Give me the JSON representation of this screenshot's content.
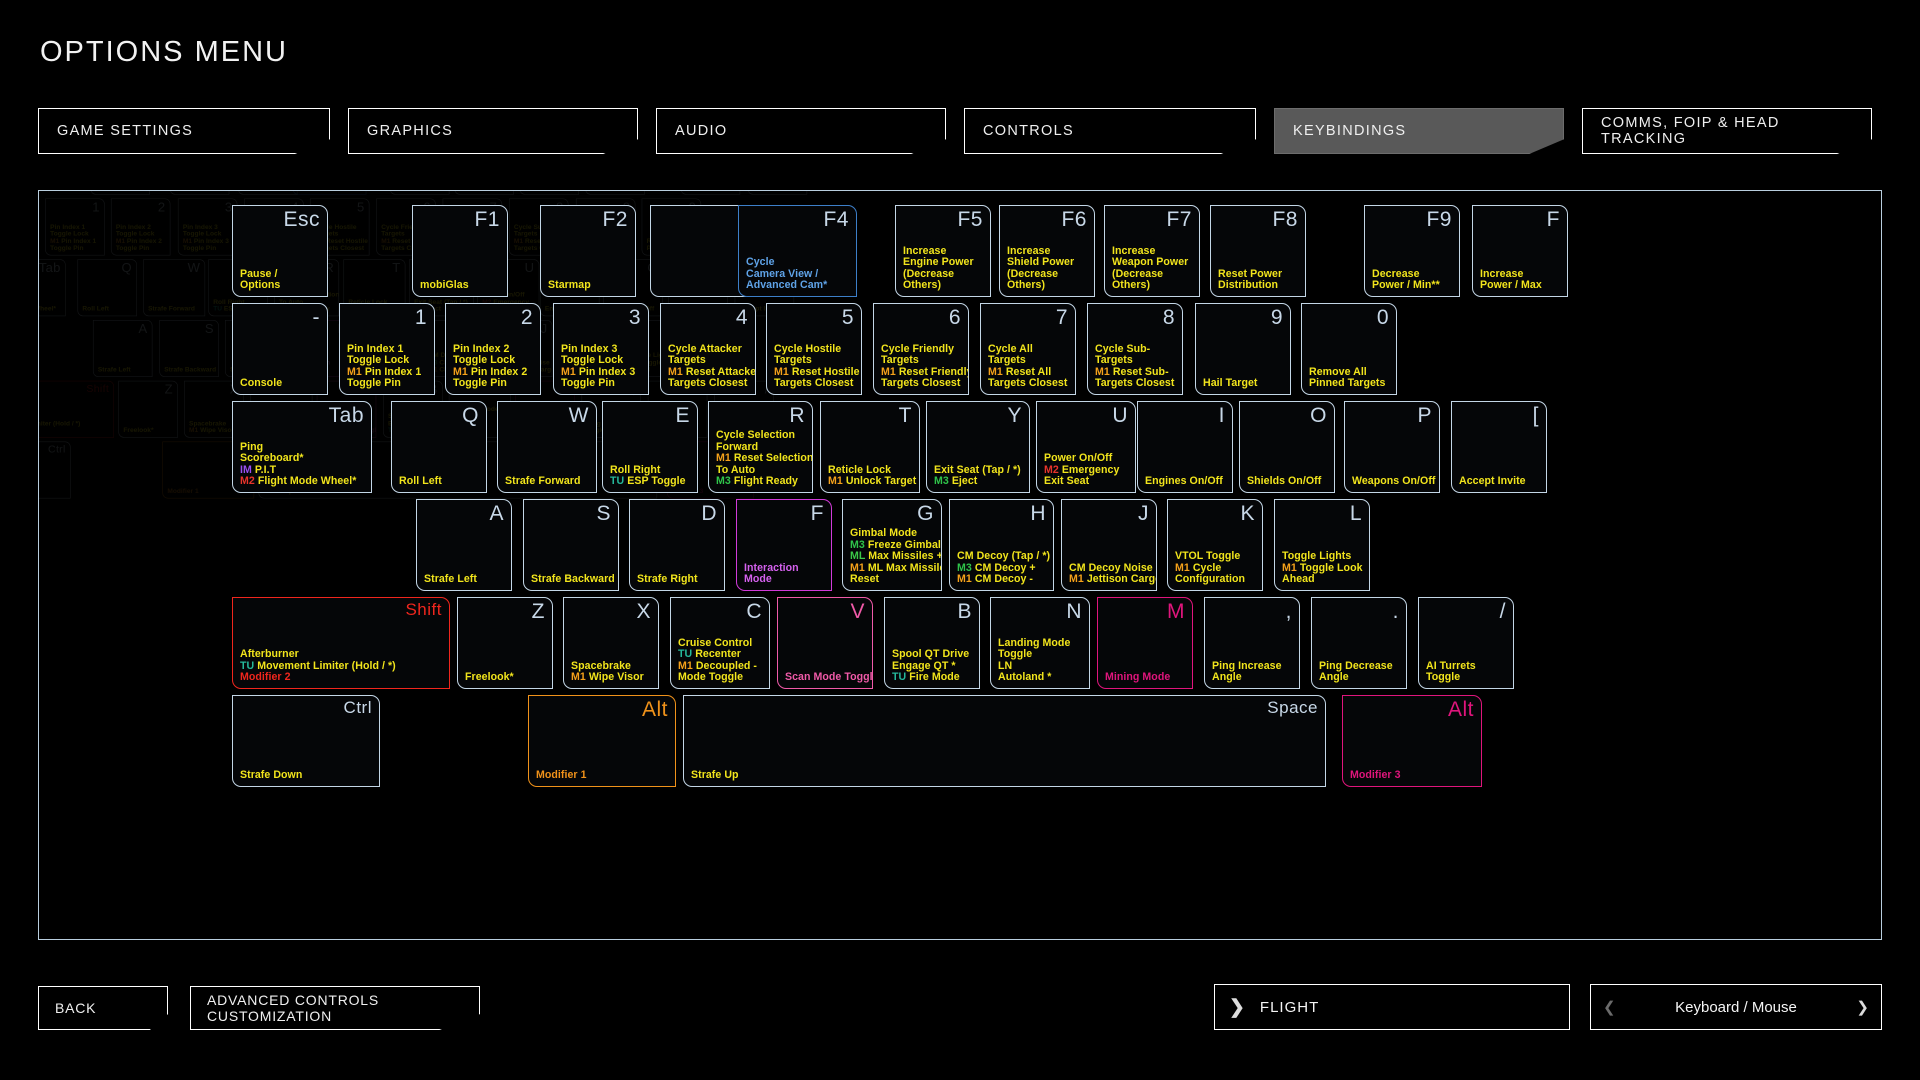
{
  "header": {
    "title": "OPTIONS MENU"
  },
  "tabs": [
    {
      "label": "GAME SETTINGS",
      "selected": false
    },
    {
      "label": "GRAPHICS",
      "selected": false
    },
    {
      "label": "AUDIO",
      "selected": false
    },
    {
      "label": "CONTROLS",
      "selected": false
    },
    {
      "label": "KEYBINDINGS",
      "selected": true
    },
    {
      "label": "COMMS, FOIP & HEAD TRACKING",
      "selected": false
    }
  ],
  "footer": {
    "back_label": "BACK",
    "advanced_label": "ADVANCED CONTROLS CUSTOMIZATION",
    "flight_label": "FLIGHT",
    "flight_icon": "chevron-right-icon",
    "device_label": "Keyboard / Mouse",
    "device_prev_icon": "chevron-left-icon",
    "device_next_icon": "chevron-right-icon"
  },
  "modifier_colors": {
    "M1": "#f5a11a",
    "M2": "#e8342b",
    "M3": "#2fc44a",
    "IM": "#9a4ff0",
    "TU": "#25b89b",
    "LN": "#f2e51c",
    "ML": "#3bc948",
    "LM": "#3bc948"
  },
  "highlight_colors": {
    "blue": "#3d7fc9",
    "magenta": "#d13ad8",
    "red": "#f0261d",
    "pink": "#f05aa8",
    "crimson": "#e0157c",
    "orange": "#f0921a"
  },
  "keyboard": {
    "row_f": [
      {
        "cap": "Esc",
        "lines": [
          {
            "t": "Pause /"
          },
          {
            "t": "Options"
          }
        ]
      },
      {
        "cap": "F1",
        "lines": [
          {
            "t": "mobiGlas"
          }
        ]
      },
      {
        "cap": "F2",
        "lines": [
          {
            "t": "Starmap"
          }
        ]
      },
      {
        "cap": "",
        "lines": []
      },
      {
        "cap": "F4",
        "highlight": "blue",
        "lines": [
          {
            "t": "Cycle",
            "c": "blue"
          },
          {
            "t": "Camera View /",
            "c": "blue"
          },
          {
            "t": "Advanced Cam*",
            "c": "blue"
          }
        ]
      },
      {
        "cap": "F5",
        "lines": [
          {
            "t": "Increase"
          },
          {
            "t": "Engine Power"
          },
          {
            "t": "(Decrease"
          },
          {
            "t": "Others)"
          }
        ]
      },
      {
        "cap": "F6",
        "lines": [
          {
            "t": "Increase"
          },
          {
            "t": "Shield Power"
          },
          {
            "t": "(Decrease"
          },
          {
            "t": "Others)"
          }
        ]
      },
      {
        "cap": "F7",
        "lines": [
          {
            "t": "Increase"
          },
          {
            "t": "Weapon Power"
          },
          {
            "t": "(Decrease"
          },
          {
            "t": "Others)"
          }
        ]
      },
      {
        "cap": "F8",
        "lines": [
          {
            "t": "Reset Power"
          },
          {
            "t": "Distribution"
          }
        ]
      },
      {
        "cap": "F9",
        "lines": [
          {
            "t": "Decrease"
          },
          {
            "t": "Power / Min**"
          }
        ]
      },
      {
        "cap": "F",
        "lines": [
          {
            "t": "Increase"
          },
          {
            "t": "Power / Max"
          }
        ]
      }
    ],
    "row_num": [
      {
        "cap": "-",
        "lines": [
          {
            "t": "Console"
          }
        ]
      },
      {
        "cap": "1",
        "lines": [
          {
            "t": "Pin Index 1"
          },
          {
            "t": "Toggle Lock"
          },
          {
            "m": "M1",
            "t": "Pin Index 1"
          },
          {
            "t": "Toggle Pin"
          }
        ]
      },
      {
        "cap": "2",
        "lines": [
          {
            "t": "Pin Index 2"
          },
          {
            "t": "Toggle Lock"
          },
          {
            "m": "M1",
            "t": "Pin Index 2"
          },
          {
            "t": "Toggle Pin"
          }
        ]
      },
      {
        "cap": "3",
        "lines": [
          {
            "t": "Pin Index 3"
          },
          {
            "t": "Toggle Lock"
          },
          {
            "m": "M1",
            "t": "Pin Index 3"
          },
          {
            "t": "Toggle Pin"
          }
        ]
      },
      {
        "cap": "4",
        "lines": [
          {
            "t": "Cycle Attacker"
          },
          {
            "t": "Targets"
          },
          {
            "m": "M1",
            "t": "Reset Attacker"
          },
          {
            "t": "Targets Closest"
          }
        ]
      },
      {
        "cap": "5",
        "lines": [
          {
            "t": "Cycle Hostile"
          },
          {
            "t": "Targets"
          },
          {
            "m": "M1",
            "t": "Reset Hostile"
          },
          {
            "t": "Targets Closest"
          }
        ]
      },
      {
        "cap": "6",
        "lines": [
          {
            "t": "Cycle Friendly"
          },
          {
            "t": "Targets"
          },
          {
            "m": "M1",
            "t": "Reset Friendly"
          },
          {
            "t": "Targets Closest"
          }
        ]
      },
      {
        "cap": "7",
        "lines": [
          {
            "t": "Cycle All"
          },
          {
            "t": "Targets"
          },
          {
            "m": "M1",
            "t": "Reset All"
          },
          {
            "t": "Targets Closest"
          }
        ]
      },
      {
        "cap": "8",
        "lines": [
          {
            "t": "Cycle Sub-"
          },
          {
            "t": "Targets"
          },
          {
            "m": "M1",
            "t": "Reset Sub-"
          },
          {
            "t": "Targets Closest"
          }
        ]
      },
      {
        "cap": "9",
        "lines": [
          {
            "t": "Hail Target"
          }
        ]
      },
      {
        "cap": "0",
        "lines": [
          {
            "t": "Remove All"
          },
          {
            "t": "Pinned Targets"
          }
        ]
      }
    ],
    "row_q": [
      {
        "cap": "Tab",
        "lines": [
          {
            "t": "Ping"
          },
          {
            "t": "Scoreboard*"
          },
          {
            "m": "IM",
            "t": "P.I.T"
          },
          {
            "m": "M2",
            "t": "Flight Mode Wheel*"
          }
        ]
      },
      {
        "cap": "Q",
        "lines": [
          {
            "t": "Roll Left"
          }
        ]
      },
      {
        "cap": "W",
        "lines": [
          {
            "t": "Strafe Forward"
          }
        ]
      },
      {
        "cap": "E",
        "lines": [
          {
            "t": "Roll Right"
          },
          {
            "m": "TU",
            "t": "ESP Toggle"
          }
        ]
      },
      {
        "cap": "R",
        "lines": [
          {
            "t": "Cycle Selection"
          },
          {
            "t": "Forward"
          },
          {
            "m": "M1",
            "t": "Reset Selection"
          },
          {
            "t": "To Auto"
          },
          {
            "m": "M3",
            "t": "Flight Ready"
          }
        ]
      },
      {
        "cap": "T",
        "lines": [
          {
            "t": "Reticle Lock"
          },
          {
            "m": "M1",
            "t": "Unlock Target"
          }
        ]
      },
      {
        "cap": "Y",
        "lines": [
          {
            "t": "Exit Seat (Tap / *)"
          },
          {
            "m": "M3",
            "t": "Eject"
          }
        ]
      },
      {
        "cap": "U",
        "lines": [
          {
            "t": "Power On/Off"
          },
          {
            "m": "M2",
            "t": "Emergency"
          },
          {
            "t": "Exit Seat"
          }
        ]
      },
      {
        "cap": "I",
        "lines": [
          {
            "t": "Engines On/Off"
          }
        ]
      },
      {
        "cap": "O",
        "lines": [
          {
            "t": "Shields On/Off"
          }
        ]
      },
      {
        "cap": "P",
        "lines": [
          {
            "t": "Weapons On/Off"
          }
        ]
      },
      {
        "cap": "[",
        "lines": [
          {
            "t": "Accept Invite"
          }
        ]
      }
    ],
    "row_a": [
      {
        "cap": "A",
        "lines": [
          {
            "t": "Strafe Left"
          }
        ]
      },
      {
        "cap": "S",
        "lines": [
          {
            "t": "Strafe Backward"
          }
        ]
      },
      {
        "cap": "D",
        "lines": [
          {
            "t": "Strafe Right"
          }
        ]
      },
      {
        "cap": "F",
        "highlight": "magenta",
        "lines": [
          {
            "t": "Interaction",
            "c": "magenta"
          },
          {
            "t": "Mode",
            "c": "magenta"
          }
        ]
      },
      {
        "cap": "G",
        "lines": [
          {
            "t": "Gimbal Mode"
          },
          {
            "m": "M3",
            "t": "Freeze Gimbals"
          },
          {
            "m": "ML",
            "t": "Max Missiles +"
          },
          {
            "m": "M1",
            "t": "ML Max Missiles"
          },
          {
            "t": "Reset"
          }
        ]
      },
      {
        "cap": "H",
        "lines": [
          {
            "t": "CM Decoy (Tap / *)"
          },
          {
            "m": "M3",
            "t": "CM Decoy +"
          },
          {
            "m": "M1",
            "t": "CM Decoy -"
          }
        ]
      },
      {
        "cap": "J",
        "lines": [
          {
            "t": "CM Decoy Noise"
          },
          {
            "m": "M1",
            "t": "Jettison Cargo"
          }
        ]
      },
      {
        "cap": "K",
        "lines": [
          {
            "t": "VTOL Toggle"
          },
          {
            "m": "M1",
            "t": "Cycle"
          },
          {
            "t": "Configuration"
          }
        ]
      },
      {
        "cap": "L",
        "lines": [
          {
            "t": "Toggle Lights"
          },
          {
            "m": "M1",
            "t": "Toggle Look"
          },
          {
            "t": "Ahead"
          }
        ]
      }
    ],
    "row_z": [
      {
        "cap": "Shift",
        "highlight": "red",
        "cap_color": "red",
        "lines": [
          {
            "t": "Afterburner"
          },
          {
            "m": "TU",
            "t": "Movement Limiter (Hold / *)"
          },
          {
            "t": "Modifier 2",
            "c": "red"
          }
        ]
      },
      {
        "cap": "Z",
        "lines": [
          {
            "t": "Freelook*"
          }
        ]
      },
      {
        "cap": "X",
        "lines": [
          {
            "t": "Spacebrake"
          },
          {
            "m": "M1",
            "t": "Wipe Visor"
          }
        ]
      },
      {
        "cap": "C",
        "lines": [
          {
            "t": "Cruise Control"
          },
          {
            "m": "TU",
            "t": "Recenter"
          },
          {
            "m": "M1",
            "t": "Decoupled -"
          },
          {
            "t": "Mode Toggle"
          }
        ]
      },
      {
        "cap": "V",
        "highlight": "pink",
        "cap_color": "pink",
        "lines": [
          {
            "t": "Scan Mode Toggle",
            "c": "pink"
          }
        ]
      },
      {
        "cap": "B",
        "lines": [
          {
            "t": "Spool QT Drive"
          },
          {
            "t": "Engage QT *"
          },
          {
            "m": "TU",
            "t": "Fire Mode"
          }
        ]
      },
      {
        "cap": "N",
        "lines": [
          {
            "t": "Landing Mode",
            "c": "yellow"
          },
          {
            "t": "Toggle",
            "c": "yellow"
          },
          {
            "m": "LN",
            "t": "Autoland *"
          }
        ]
      },
      {
        "cap": "M",
        "highlight": "crimson",
        "cap_color": "crimson",
        "lines": [
          {
            "t": "Mining Mode",
            "c": "crimson"
          }
        ]
      },
      {
        "cap": ",",
        "lines": [
          {
            "t": "Ping Increase"
          },
          {
            "t": "Angle"
          }
        ]
      },
      {
        "cap": ".",
        "lines": [
          {
            "t": "Ping Decrease"
          },
          {
            "t": "Angle"
          }
        ]
      },
      {
        "cap": "/",
        "lines": [
          {
            "t": "AI Turrets"
          },
          {
            "t": "Toggle"
          }
        ]
      }
    ],
    "row_space": [
      {
        "cap": "Ctrl",
        "lines": [
          {
            "t": "Strafe Down"
          }
        ]
      },
      {
        "cap": "Alt",
        "highlight": "orange",
        "cap_color": "orange",
        "lines": [
          {
            "t": "Modifier 1",
            "c": "orange"
          }
        ]
      },
      {
        "cap": "Space",
        "lines": [
          {
            "t": "Strafe Up"
          }
        ]
      },
      {
        "cap": "Alt",
        "highlight": "crimson",
        "cap_color": "crimson",
        "lines": [
          {
            "t": "Modifier 3",
            "c": "crimson"
          }
        ]
      }
    ]
  }
}
